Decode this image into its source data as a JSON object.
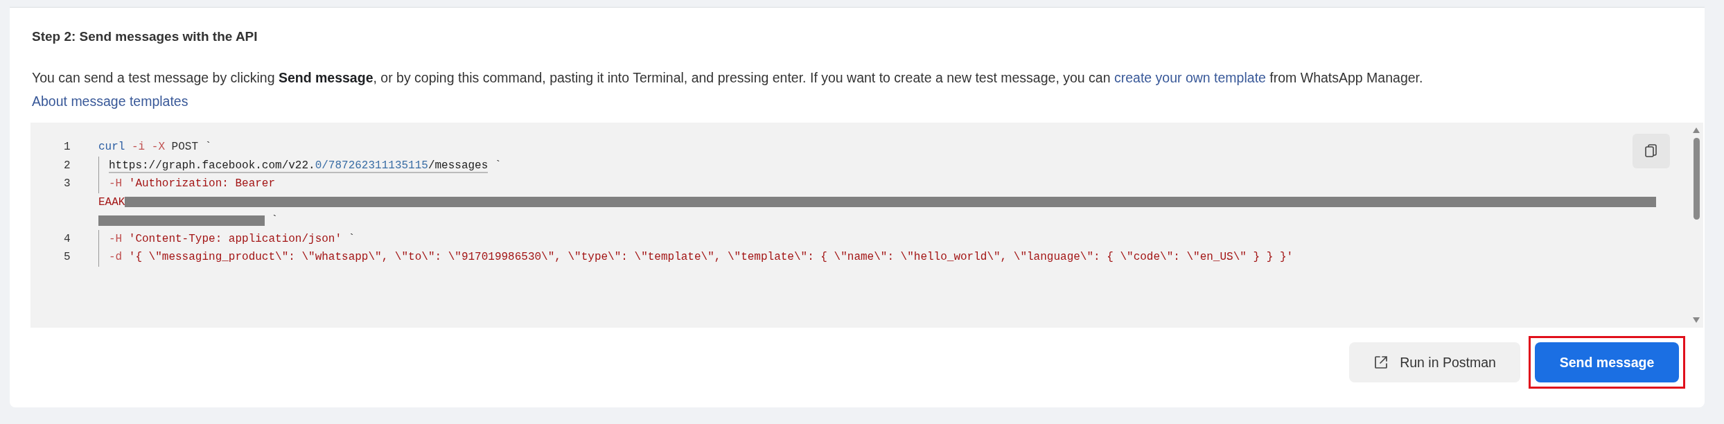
{
  "heading": "Step 2: Send messages with the API",
  "description": "You can send a test message by clicking **Send message**, or by coping this command, pasting it into Terminal, and pressing enter. If you want to create a new test message, you can ",
  "description_link": "create your own template",
  "description_end": " from WhatsApp Manager.",
  "about_link": "About message templates",
  "code_lines": [
    {
      "number": "1",
      "indent": false,
      "tokens": [
        {
          "kind": "keyword",
          "text": "curl"
        },
        {
          "kind": "flag",
          "text": " -i -X"
        },
        {
          "kind": "plain",
          "text": " POST `"
        }
      ]
    },
    {
      "number": "2",
      "indent": true,
      "tokens": [
        {
          "kind": "url",
          "text": "https://graph.facebook.com/v22."
        },
        {
          "kind": "url_number",
          "text": "0/787262311135115"
        },
        {
          "kind": "url",
          "text": "/messages"
        },
        {
          "kind": "plain",
          "text": " `"
        }
      ]
    },
    {
      "number": "3",
      "indent": true,
      "tokens": [
        {
          "kind": "flag",
          "text": "-H"
        },
        {
          "kind": "string",
          "text": " 'Authorization: Bearer"
        }
      ]
    },
    {
      "indent": false,
      "tokens": [
        {
          "kind": "string",
          "text": "EAAK"
        },
        {
          "kind": "redacted_long"
        }
      ]
    },
    {
      "indent": false,
      "tokens": [
        {
          "kind": "redacted_short"
        },
        {
          "kind": "plain",
          "text": " `"
        }
      ]
    },
    {
      "number": "4",
      "indent": true,
      "tokens": [
        {
          "kind": "flag",
          "text": "-H"
        },
        {
          "kind": "string",
          "text": " 'Content-Type: application/json'"
        },
        {
          "kind": "plain",
          "text": " `"
        }
      ]
    },
    {
      "number": "5",
      "indent": true,
      "tokens": [
        {
          "kind": "flag",
          "text": "-d"
        },
        {
          "kind": "string",
          "text": " '{ \\\"messaging_product\\\": \\\"whatsapp\\\", \\\"to\\\": \\\"917019986530\\\", \\\"type\\\": \\\"template\\\", \\\"template\\\": { \\\"name\\\": \\\"hello_world\\\", \\\"language\\\": { \\\"code\\\": \\\"en_US\\\" } } }'"
        }
      ]
    }
  ],
  "buttons": [
    {
      "kind": "secondary",
      "label": "Run in Postman",
      "highlighted": false
    },
    {
      "kind": "primary",
      "label": "Send message",
      "highlighted": true
    }
  ]
}
